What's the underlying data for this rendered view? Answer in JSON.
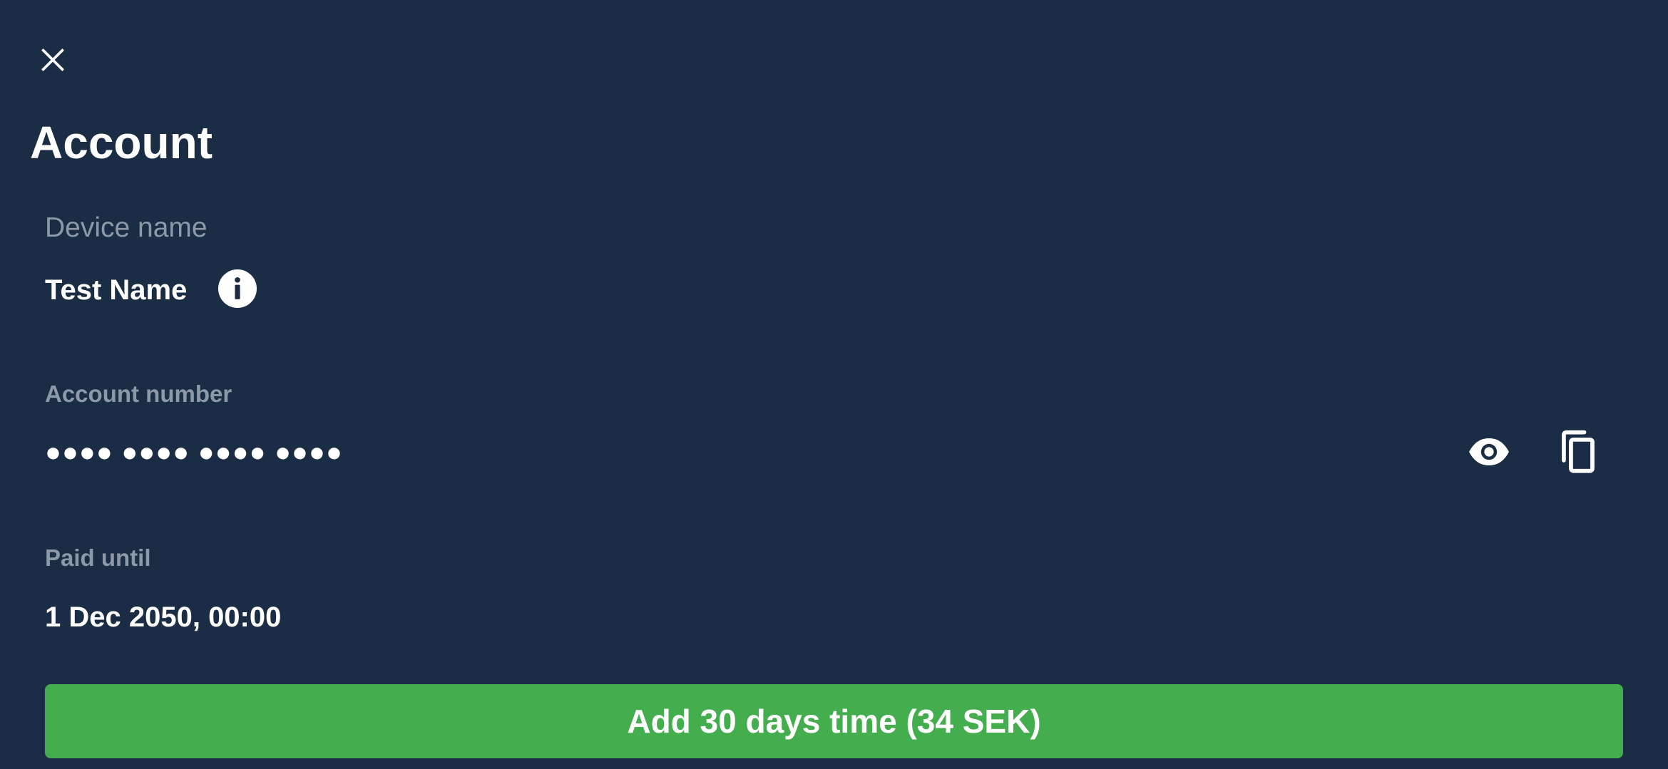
{
  "header": {
    "close_icon": "close-icon",
    "title": "Account"
  },
  "device": {
    "label": "Device name",
    "value": "Test Name",
    "info_icon": "info-icon"
  },
  "account": {
    "label": "Account number",
    "value": "●●●● ●●●● ●●●● ●●●●",
    "show_icon": "eye-icon",
    "copy_icon": "copy-icon"
  },
  "paid": {
    "label": "Paid until",
    "value": "1 Dec 2050, 00:00"
  },
  "actions": {
    "add_time_label": "Add 30 days time (34 SEK)"
  },
  "colors": {
    "background": "#1b2d45",
    "label_muted": "#8d99a8",
    "text": "#ffffff",
    "button_green": "#44ad4d"
  }
}
